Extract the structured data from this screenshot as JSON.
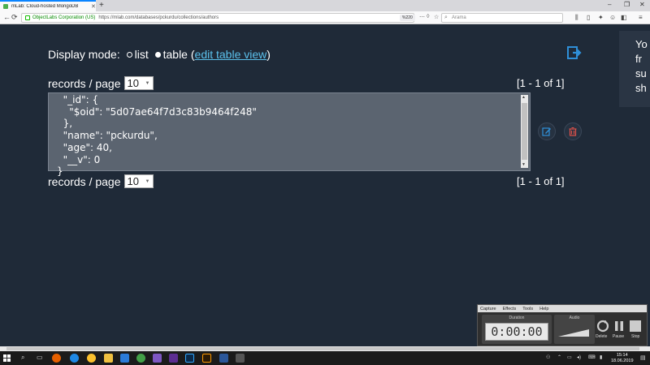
{
  "browser": {
    "tab_title": "mLab: Cloud-hosted MongoDB",
    "new_tab": "+",
    "org": "ObjectLabs Corporation (US)",
    "url": "https://mlab.com/databases/pckurdu/collections/authors",
    "zoom": "%220",
    "search_placeholder": "Arama"
  },
  "page": {
    "display_mode_label": "Display mode:",
    "list_label": "list",
    "table_label": "table",
    "edit_table_view": "edit table view",
    "side_tip_lines": [
      "Yo",
      "fr",
      "su",
      "sh"
    ],
    "records_per_page_label": "records / page",
    "records_per_page_value": "10",
    "range_text": "[1 - 1 of 1]",
    "document_text": "  \"_id\": {\n    \"$oid\": \"5d07ae64f7d3c83b9464f248\"\n  },\n  \"name\": \"pckurdu\",\n  \"age\": 40,\n  \"__v\": 0\n}"
  },
  "recorder": {
    "menu": [
      "Capture",
      "Effects",
      "Tools",
      "Help"
    ],
    "duration_label": "Duration",
    "duration_value": "0:00:00",
    "audio_label": "Audio",
    "delete_label": "Delete",
    "pause_label": "Pause",
    "stop_label": "Stop"
  },
  "taskbar": {
    "time": "15:14",
    "date": "18.06.2019"
  },
  "colors": {
    "background": "#1f2a38",
    "link": "#5bc0eb",
    "edit": "#2f8fd8",
    "delete": "#e0524a"
  }
}
